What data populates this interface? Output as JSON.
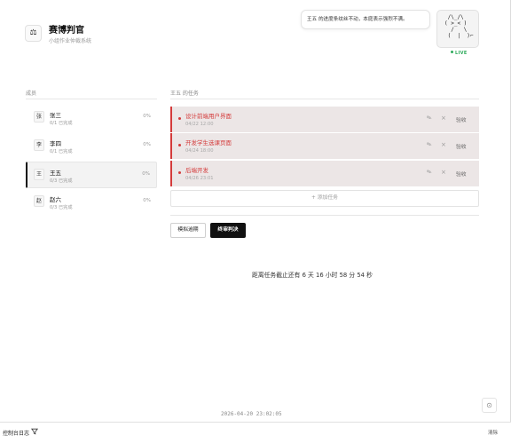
{
  "app": {
    "logo_glyph": "⚖",
    "title": "赛博判官",
    "subtitle": "小组作业仲裁系统"
  },
  "judge": {
    "speech": "王五 的进度条纹丝不动，本庭表示强烈不满。",
    "ascii_face": " /\\_/\\\n( >_< )\n  /   \\\n (  |  )⌐",
    "live_label": "LIVE"
  },
  "members": {
    "heading": "成员",
    "items": [
      {
        "avatar": "张",
        "name": "张三",
        "progress": "0/1 已完成",
        "percent": "0%"
      },
      {
        "avatar": "李",
        "name": "李四",
        "progress": "0/1 已完成",
        "percent": "0%"
      },
      {
        "avatar": "王",
        "name": "王五",
        "progress": "0/3 已完成",
        "percent": "0%"
      },
      {
        "avatar": "赵",
        "name": "赵六",
        "progress": "0/3 已完成",
        "percent": "0%"
      }
    ]
  },
  "tasks": {
    "heading": "王五 的任务",
    "items": [
      {
        "name": "设计前端用户界面",
        "deadline": "04/22 12:00",
        "accept_label": "验收"
      },
      {
        "name": "开发学生选课页面",
        "deadline": "04/24 18:00",
        "accept_label": "验收"
      },
      {
        "name": "后端开发",
        "deadline": "04/26 23:01",
        "accept_label": "验收"
      }
    ],
    "add_label": "+ 添加任务"
  },
  "actions": {
    "simulate_label": "模拟逾期",
    "judge_label": "终审判决"
  },
  "countdown": "距离任务截止还有 6 天 16 小时 58 分 54 秒",
  "footer_timestamp": "2026-04-20 23:02:05",
  "console": {
    "label": "控制台日志",
    "clear_label": "清除"
  },
  "colors": {
    "overdue_accent": "#d43b3b",
    "live_green": "#2eaa5c",
    "primary_button": "#111111"
  }
}
